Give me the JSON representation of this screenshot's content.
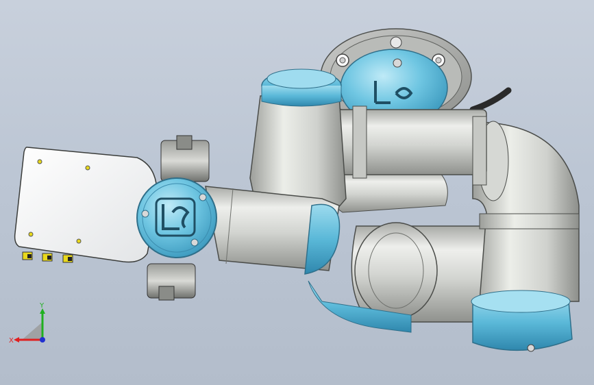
{
  "viewport": {
    "background": "#c0c9d6",
    "model_name": "ur-robot-arm-assembly",
    "colors": {
      "joint_cap": "#5ab8d8",
      "arm_tube": "#cfd2cf",
      "gripper_plate": "#f4f4f4",
      "fastener": "#e8d81c"
    }
  },
  "triad": {
    "y_label": "Y",
    "x_label": "X",
    "colors": {
      "x": "#e02020",
      "y": "#20b020",
      "z": "#2030d0"
    }
  }
}
